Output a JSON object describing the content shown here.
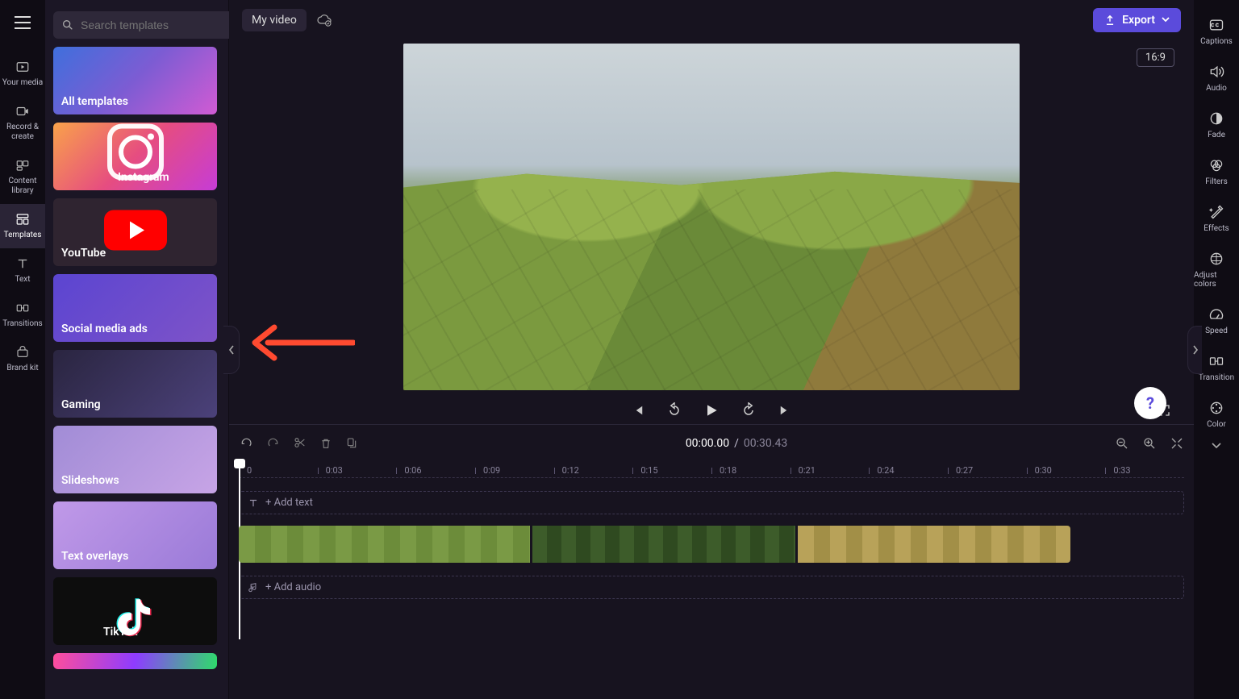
{
  "leftnav": {
    "items": [
      {
        "label": "Your media"
      },
      {
        "label": "Record & create"
      },
      {
        "label": "Content library"
      },
      {
        "label": "Templates"
      },
      {
        "label": "Text"
      },
      {
        "label": "Transitions"
      },
      {
        "label": "Brand kit"
      }
    ]
  },
  "panel": {
    "search_placeholder": "Search templates",
    "templates": [
      {
        "label": "All templates"
      },
      {
        "label": "Instagram"
      },
      {
        "label": "YouTube"
      },
      {
        "label": "Social media ads"
      },
      {
        "label": "Gaming"
      },
      {
        "label": "Slideshows"
      },
      {
        "label": "Text overlays"
      },
      {
        "label": "TikTok"
      }
    ]
  },
  "topbar": {
    "project_name": "My video",
    "export_label": "Export",
    "aspect": "16:9"
  },
  "player": {},
  "timeline": {
    "current": "00:00.00",
    "total": "00:30.43",
    "sep": "/",
    "ticks": [
      "0",
      "0:03",
      "0:06",
      "0:09",
      "0:12",
      "0:15",
      "0:18",
      "0:21",
      "0:24",
      "0:27",
      "0:30",
      "0:33"
    ],
    "add_text_label": "+ Add text",
    "add_audio_label": "+ Add audio"
  },
  "righttools": {
    "items": [
      {
        "label": "Captions"
      },
      {
        "label": "Audio"
      },
      {
        "label": "Fade"
      },
      {
        "label": "Filters"
      },
      {
        "label": "Effects"
      },
      {
        "label": "Adjust colors"
      },
      {
        "label": "Speed"
      },
      {
        "label": "Transition"
      },
      {
        "label": "Color"
      }
    ]
  },
  "help_label": "?"
}
